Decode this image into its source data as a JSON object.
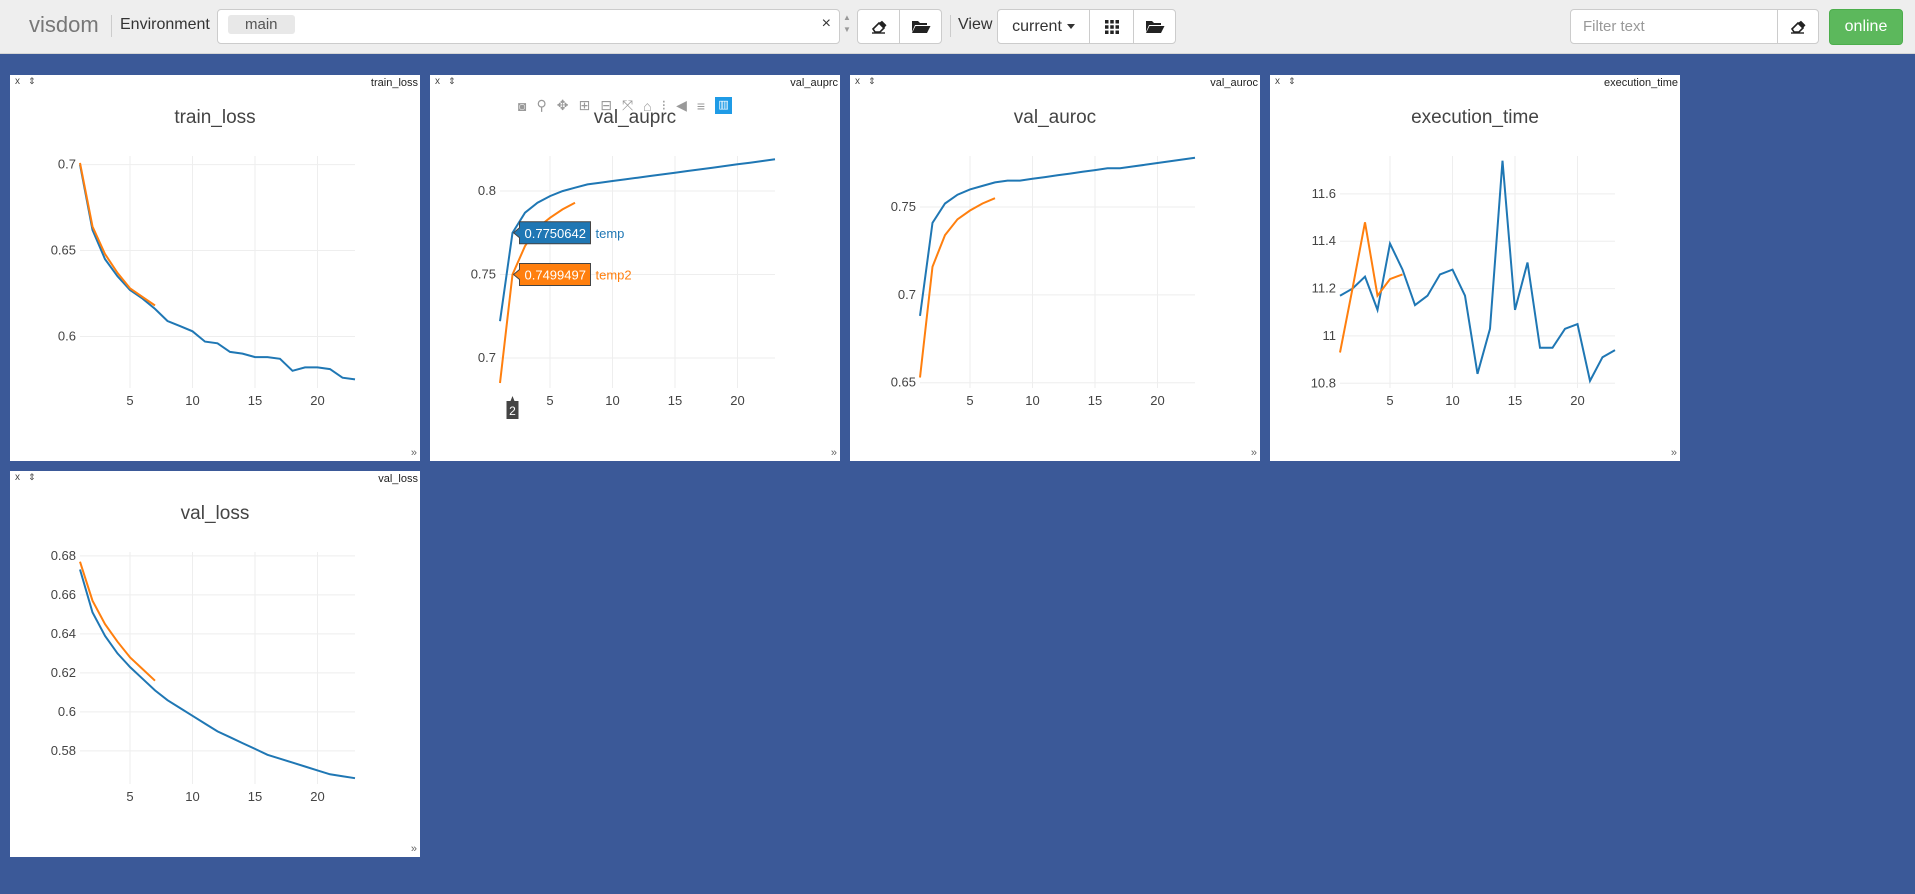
{
  "navbar": {
    "brand": "visdom",
    "environment_label": "Environment",
    "environment_value": "main",
    "view_label": "View",
    "view_value": "current",
    "filter_placeholder": "Filter text",
    "online_label": "online"
  },
  "panes": [
    {
      "window_name": "train_loss",
      "chart_data": {
        "type": "line",
        "title": "train_loss",
        "xlim": [
          1,
          23
        ],
        "ylim": [
          0.57,
          0.705
        ],
        "xticks": [
          5,
          10,
          15,
          20
        ],
        "yticks": [
          0.6,
          0.65,
          0.7
        ],
        "ytick_labels": [
          "0.6",
          "0.65",
          "0.7"
        ],
        "series": [
          {
            "color": "#1f77b4",
            "x": [
              1,
              2,
              3,
              4,
              5,
              6,
              7,
              8,
              9,
              10,
              11,
              12,
              13,
              14,
              15,
              16,
              17,
              18,
              19,
              20,
              21,
              22,
              23
            ],
            "values": [
              0.7,
              0.662,
              0.645,
              0.635,
              0.627,
              0.622,
              0.616,
              0.609,
              0.606,
              0.603,
              0.597,
              0.596,
              0.591,
              0.59,
              0.588,
              0.588,
              0.587,
              0.58,
              0.582,
              0.582,
              0.581,
              0.576,
              0.575
            ]
          },
          {
            "color": "#ff7f0e",
            "x": [
              1,
              2,
              3,
              4,
              5,
              6,
              7
            ],
            "values": [
              0.701,
              0.664,
              0.648,
              0.637,
              0.628,
              0.623,
              0.618
            ]
          }
        ]
      }
    },
    {
      "window_name": "val_auprc",
      "chart_data": {
        "type": "line",
        "title": "val_auprc",
        "xlim": [
          1,
          23
        ],
        "ylim": [
          0.682,
          0.821
        ],
        "xticks": [
          5,
          10,
          15,
          20
        ],
        "yticks": [
          0.7,
          0.75,
          0.8
        ],
        "ytick_labels": [
          "0.7",
          "0.75",
          "0.8"
        ],
        "series": [
          {
            "name": "temp",
            "color": "#1f77b4",
            "x": [
              1,
              2,
              3,
              4,
              5,
              6,
              7,
              8,
              9,
              10,
              11,
              12,
              13,
              14,
              15,
              16,
              17,
              18,
              19,
              20,
              21,
              22,
              23
            ],
            "values": [
              0.722,
              0.775,
              0.787,
              0.793,
              0.797,
              0.8,
              0.802,
              0.804,
              0.805,
              0.806,
              0.807,
              0.808,
              0.809,
              0.81,
              0.811,
              0.812,
              0.813,
              0.814,
              0.815,
              0.816,
              0.817,
              0.818,
              0.819
            ]
          },
          {
            "name": "temp2",
            "color": "#ff7f0e",
            "x": [
              1,
              2,
              3,
              4,
              5,
              6,
              7
            ],
            "values": [
              0.685,
              0.75,
              0.767,
              0.778,
              0.784,
              0.789,
              0.793
            ]
          }
        ],
        "hover": {
          "x": 2,
          "x_label": "2",
          "labels": [
            "0.7750642",
            "0.7499497"
          ]
        }
      }
    },
    {
      "window_name": "val_auroc",
      "chart_data": {
        "type": "line",
        "title": "val_auroc",
        "xlim": [
          1,
          23
        ],
        "ylim": [
          0.647,
          0.779
        ],
        "xticks": [
          5,
          10,
          15,
          20
        ],
        "yticks": [
          0.65,
          0.7,
          0.75
        ],
        "ytick_labels": [
          "0.65",
          "0.7",
          "0.75"
        ],
        "series": [
          {
            "color": "#1f77b4",
            "x": [
              1,
              2,
              3,
              4,
              5,
              6,
              7,
              8,
              9,
              10,
              11,
              12,
              13,
              14,
              15,
              16,
              17,
              18,
              19,
              20,
              21,
              22,
              23
            ],
            "values": [
              0.688,
              0.741,
              0.752,
              0.757,
              0.76,
              0.762,
              0.764,
              0.765,
              0.765,
              0.766,
              0.767,
              0.768,
              0.769,
              0.77,
              0.771,
              0.772,
              0.772,
              0.773,
              0.774,
              0.775,
              0.776,
              0.777,
              0.778
            ]
          },
          {
            "color": "#ff7f0e",
            "x": [
              1,
              2,
              3,
              4,
              5,
              6,
              7
            ],
            "values": [
              0.653,
              0.716,
              0.734,
              0.743,
              0.748,
              0.752,
              0.755
            ]
          }
        ]
      }
    },
    {
      "window_name": "execution_time",
      "chart_data": {
        "type": "line",
        "title": "execution_time",
        "xlim": [
          1,
          23
        ],
        "ylim": [
          10.78,
          11.76
        ],
        "xticks": [
          5,
          10,
          15,
          20
        ],
        "yticks": [
          10.8,
          11,
          11.2,
          11.4,
          11.6
        ],
        "ytick_labels": [
          "10.8",
          "11",
          "11.2",
          "11.4",
          "11.6"
        ],
        "series": [
          {
            "color": "#1f77b4",
            "x": [
              1,
              2,
              3,
              4,
              5,
              6,
              7,
              8,
              9,
              10,
              11,
              12,
              13,
              14,
              15,
              16,
              17,
              18,
              19,
              20,
              21,
              22,
              23
            ],
            "values": [
              11.17,
              11.2,
              11.25,
              11.11,
              11.39,
              11.28,
              11.13,
              11.17,
              11.26,
              11.28,
              11.17,
              10.84,
              11.03,
              11.74,
              11.11,
              11.31,
              10.95,
              10.95,
              11.03,
              11.05,
              10.81,
              10.91,
              10.94
            ]
          },
          {
            "color": "#ff7f0e",
            "x": [
              1,
              2,
              3,
              4,
              5,
              6,
              7
            ],
            "values": [
              10.93,
              11.2,
              11.48,
              11.17,
              11.24,
              11.26,
              null
            ]
          }
        ]
      }
    },
    {
      "window_name": "val_loss",
      "chart_data": {
        "type": "line",
        "title": "val_loss",
        "xlim": [
          1,
          23
        ],
        "ylim": [
          0.563,
          0.682
        ],
        "xticks": [
          5,
          10,
          15,
          20
        ],
        "yticks": [
          0.58,
          0.6,
          0.62,
          0.64,
          0.66,
          0.68
        ],
        "ytick_labels": [
          "0.58",
          "0.6",
          "0.62",
          "0.64",
          "0.66",
          "0.68"
        ],
        "series": [
          {
            "color": "#1f77b4",
            "x": [
              1,
              2,
              3,
              4,
              5,
              6,
              7,
              8,
              9,
              10,
              11,
              12,
              13,
              14,
              15,
              16,
              17,
              18,
              19,
              20,
              21,
              22,
              23
            ],
            "values": [
              0.673,
              0.651,
              0.639,
              0.63,
              0.623,
              0.617,
              0.611,
              0.606,
              0.602,
              0.598,
              0.594,
              0.59,
              0.587,
              0.584,
              0.581,
              0.578,
              0.576,
              0.574,
              0.572,
              0.57,
              0.568,
              0.567,
              0.566
            ]
          },
          {
            "color": "#ff7f0e",
            "x": [
              1,
              2,
              3,
              4,
              5,
              6,
              7
            ],
            "values": [
              0.677,
              0.657,
              0.645,
              0.636,
              0.628,
              0.622,
              0.616
            ]
          }
        ]
      }
    }
  ]
}
